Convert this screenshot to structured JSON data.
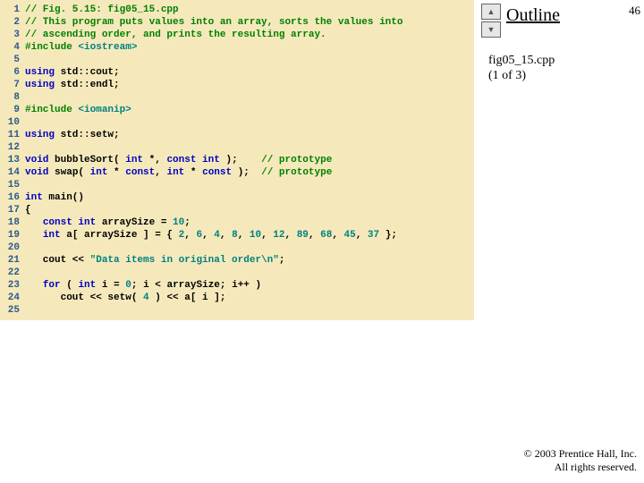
{
  "sidebar": {
    "outline_label": "Outline",
    "page_number": "46",
    "file_label_line1": "fig05_15.cpp",
    "file_label_line2": "(1 of 3)"
  },
  "copyright": {
    "line1": "© 2003 Prentice Hall, Inc.",
    "line2": "All rights reserved."
  },
  "code": {
    "lines": [
      {
        "n": "1",
        "tokens": [
          [
            "comment",
            "// Fig. 5.15: fig05_15.cpp"
          ]
        ]
      },
      {
        "n": "2",
        "tokens": [
          [
            "comment",
            "// This program puts values into an array, sorts the values into"
          ]
        ]
      },
      {
        "n": "3",
        "tokens": [
          [
            "comment",
            "// ascending order, and prints the resulting array."
          ]
        ]
      },
      {
        "n": "4",
        "tokens": [
          [
            "prep",
            "#include "
          ],
          [
            "literal",
            "<iostream>"
          ]
        ]
      },
      {
        "n": "5",
        "tokens": []
      },
      {
        "n": "6",
        "tokens": [
          [
            "keyword",
            "using "
          ],
          [
            "plain",
            "std::cout;"
          ]
        ]
      },
      {
        "n": "7",
        "tokens": [
          [
            "keyword",
            "using "
          ],
          [
            "plain",
            "std::endl;"
          ]
        ]
      },
      {
        "n": "8",
        "tokens": []
      },
      {
        "n": "9",
        "tokens": [
          [
            "prep",
            "#include "
          ],
          [
            "literal",
            "<iomanip>"
          ]
        ]
      },
      {
        "n": "10",
        "tokens": []
      },
      {
        "n": "11",
        "tokens": [
          [
            "keyword",
            "using "
          ],
          [
            "plain",
            "std::setw;"
          ]
        ]
      },
      {
        "n": "12",
        "tokens": []
      },
      {
        "n": "13",
        "tokens": [
          [
            "keyword",
            "void "
          ],
          [
            "plain",
            "bubbleSort( "
          ],
          [
            "keyword",
            "int"
          ],
          [
            "plain",
            " *, "
          ],
          [
            "keyword",
            "const int"
          ],
          [
            "plain",
            " );    "
          ],
          [
            "comment",
            "// prototype"
          ]
        ]
      },
      {
        "n": "14",
        "tokens": [
          [
            "keyword",
            "void "
          ],
          [
            "plain",
            "swap( "
          ],
          [
            "keyword",
            "int"
          ],
          [
            "plain",
            " * "
          ],
          [
            "keyword",
            "const"
          ],
          [
            "plain",
            ", "
          ],
          [
            "keyword",
            "int"
          ],
          [
            "plain",
            " * "
          ],
          [
            "keyword",
            "const"
          ],
          [
            "plain",
            " );  "
          ],
          [
            "comment",
            "// prototype"
          ]
        ]
      },
      {
        "n": "15",
        "tokens": []
      },
      {
        "n": "16",
        "tokens": [
          [
            "keyword",
            "int "
          ],
          [
            "plain",
            "main()"
          ]
        ]
      },
      {
        "n": "17",
        "tokens": [
          [
            "plain",
            "{"
          ]
        ]
      },
      {
        "n": "18",
        "tokens": [
          [
            "plain",
            "   "
          ],
          [
            "keyword",
            "const int "
          ],
          [
            "plain",
            "arraySize = "
          ],
          [
            "literal",
            "10"
          ],
          [
            "plain",
            ";"
          ]
        ]
      },
      {
        "n": "19",
        "tokens": [
          [
            "plain",
            "   "
          ],
          [
            "keyword",
            "int "
          ],
          [
            "plain",
            "a[ arraySize ] = { "
          ],
          [
            "literal",
            "2"
          ],
          [
            "plain",
            ", "
          ],
          [
            "literal",
            "6"
          ],
          [
            "plain",
            ", "
          ],
          [
            "literal",
            "4"
          ],
          [
            "plain",
            ", "
          ],
          [
            "literal",
            "8"
          ],
          [
            "plain",
            ", "
          ],
          [
            "literal",
            "10"
          ],
          [
            "plain",
            ", "
          ],
          [
            "literal",
            "12"
          ],
          [
            "plain",
            ", "
          ],
          [
            "literal",
            "89"
          ],
          [
            "plain",
            ", "
          ],
          [
            "literal",
            "68"
          ],
          [
            "plain",
            ", "
          ],
          [
            "literal",
            "45"
          ],
          [
            "plain",
            ", "
          ],
          [
            "literal",
            "37"
          ],
          [
            "plain",
            " };"
          ]
        ]
      },
      {
        "n": "20",
        "tokens": []
      },
      {
        "n": "21",
        "tokens": [
          [
            "plain",
            "   cout << "
          ],
          [
            "literal",
            "\"Data items in original order\\n\""
          ],
          [
            "plain",
            ";"
          ]
        ]
      },
      {
        "n": "22",
        "tokens": []
      },
      {
        "n": "23",
        "tokens": [
          [
            "plain",
            "   "
          ],
          [
            "keyword",
            "for"
          ],
          [
            "plain",
            " ( "
          ],
          [
            "keyword",
            "int"
          ],
          [
            "plain",
            " i = "
          ],
          [
            "literal",
            "0"
          ],
          [
            "plain",
            "; i < arraySize; i++ )"
          ]
        ]
      },
      {
        "n": "24",
        "tokens": [
          [
            "plain",
            "      cout << setw( "
          ],
          [
            "literal",
            "4"
          ],
          [
            "plain",
            " ) << a[ i ];"
          ]
        ]
      },
      {
        "n": "25",
        "tokens": []
      }
    ]
  }
}
